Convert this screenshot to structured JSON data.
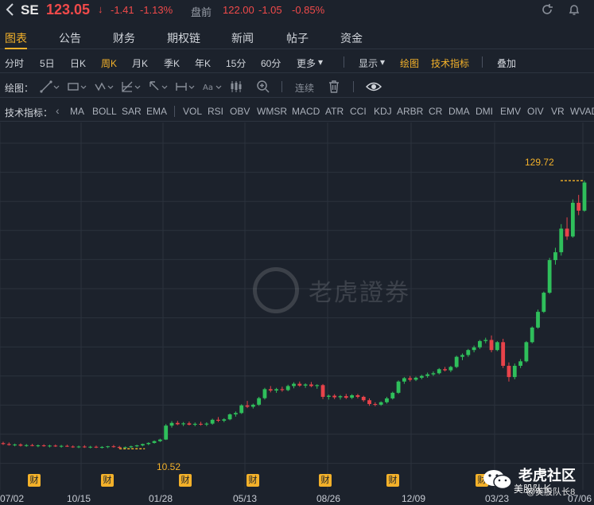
{
  "header": {
    "symbol": "SE",
    "price": "123.05",
    "price_arrow": "↓",
    "change": "-1.41",
    "change_pct": "-1.13%",
    "premarket_label": "盘前",
    "premarket_price": "122.00",
    "premarket_change": "-1.05",
    "premarket_pct": "-0.85%"
  },
  "tabs": [
    {
      "label": "图表",
      "active": true
    },
    {
      "label": "公告"
    },
    {
      "label": "财务"
    },
    {
      "label": "期权链"
    },
    {
      "label": "新闻"
    },
    {
      "label": "帖子"
    },
    {
      "label": "资金"
    }
  ],
  "periods": [
    {
      "label": "分时"
    },
    {
      "label": "5日"
    },
    {
      "label": "日K"
    },
    {
      "label": "周K",
      "active": true
    },
    {
      "label": "月K"
    },
    {
      "label": "季K"
    },
    {
      "label": "年K"
    },
    {
      "label": "15分"
    },
    {
      "label": "60分"
    },
    {
      "label": "更多"
    },
    {
      "label": "显示"
    },
    {
      "label": "绘图",
      "active": true
    },
    {
      "label": "技术指标",
      "active": true
    },
    {
      "label": "叠加"
    }
  ],
  "draw_bar": {
    "label": "绘图：",
    "continuous": "连续"
  },
  "indicators": {
    "label": "技术指标：",
    "items": [
      "MA",
      "BOLL",
      "SAR",
      "EMA",
      "VOL",
      "RSI",
      "OBV",
      "WMSR",
      "MACD",
      "ATR",
      "CCI",
      "KDJ",
      "ARBR",
      "CR",
      "DMA",
      "DMI",
      "EMV",
      "OIV",
      "VR",
      "WVAD"
    ]
  },
  "watermark": "老虎證券",
  "fin_badge": "财",
  "brand": {
    "name": "老虎社区",
    "sub": "美股队长",
    "handle": "@美股队长8"
  },
  "colors": {
    "up": "#2fbf5b",
    "down": "#e8434a",
    "accent": "#f3b12a",
    "background": "#1c222c"
  },
  "chart_data": {
    "type": "candlestick",
    "x_labels": [
      "07/02",
      "10/15",
      "01/28",
      "05/13",
      "08/26",
      "12/09",
      "03/23",
      "07/06"
    ],
    "high_marker": "129.72",
    "low_marker": "10.52",
    "y_range": [
      0,
      150
    ],
    "grid": true,
    "candles": [
      {
        "o": 13.0,
        "h": 13.6,
        "l": 12.2,
        "c": 12.6
      },
      {
        "o": 12.6,
        "h": 13.3,
        "l": 11.9,
        "c": 12.2
      },
      {
        "o": 12.2,
        "h": 12.8,
        "l": 11.6,
        "c": 12.4
      },
      {
        "o": 12.4,
        "h": 12.9,
        "l": 11.5,
        "c": 11.9
      },
      {
        "o": 11.9,
        "h": 12.6,
        "l": 11.4,
        "c": 12.1
      },
      {
        "o": 12.1,
        "h": 12.7,
        "l": 11.6,
        "c": 11.8
      },
      {
        "o": 11.8,
        "h": 12.4,
        "l": 11.2,
        "c": 12.0
      },
      {
        "o": 12.0,
        "h": 12.5,
        "l": 11.4,
        "c": 11.7
      },
      {
        "o": 11.7,
        "h": 12.3,
        "l": 11.1,
        "c": 11.9
      },
      {
        "o": 11.9,
        "h": 12.4,
        "l": 11.3,
        "c": 11.6
      },
      {
        "o": 11.6,
        "h": 12.2,
        "l": 11.0,
        "c": 11.8
      },
      {
        "o": 11.8,
        "h": 12.3,
        "l": 11.3,
        "c": 11.5
      },
      {
        "o": 11.5,
        "h": 12.0,
        "l": 10.9,
        "c": 11.3
      },
      {
        "o": 11.3,
        "h": 11.9,
        "l": 10.8,
        "c": 11.5
      },
      {
        "o": 11.5,
        "h": 12.1,
        "l": 10.9,
        "c": 11.2
      },
      {
        "o": 11.2,
        "h": 11.8,
        "l": 10.7,
        "c": 11.4
      },
      {
        "o": 11.4,
        "h": 11.9,
        "l": 10.8,
        "c": 11.1
      },
      {
        "o": 11.1,
        "h": 11.7,
        "l": 10.6,
        "c": 11.3
      },
      {
        "o": 11.3,
        "h": 11.8,
        "l": 10.8,
        "c": 11.6
      },
      {
        "o": 11.6,
        "h": 12.2,
        "l": 11.0,
        "c": 11.3
      },
      {
        "o": 11.3,
        "h": 11.8,
        "l": 10.5,
        "c": 10.9
      },
      {
        "o": 10.9,
        "h": 11.5,
        "l": 10.52,
        "c": 11.2
      },
      {
        "o": 11.2,
        "h": 11.9,
        "l": 10.8,
        "c": 11.6
      },
      {
        "o": 11.6,
        "h": 12.3,
        "l": 11.2,
        "c": 12.0
      },
      {
        "o": 12.0,
        "h": 12.8,
        "l": 11.6,
        "c": 12.6
      },
      {
        "o": 12.6,
        "h": 13.4,
        "l": 12.1,
        "c": 13.1
      },
      {
        "o": 13.1,
        "h": 14.2,
        "l": 12.8,
        "c": 13.9
      },
      {
        "o": 13.9,
        "h": 15.0,
        "l": 13.5,
        "c": 14.6
      },
      {
        "o": 14.6,
        "h": 21.5,
        "l": 14.4,
        "c": 20.8
      },
      {
        "o": 20.8,
        "h": 22.8,
        "l": 19.9,
        "c": 22.0
      },
      {
        "o": 22.0,
        "h": 22.9,
        "l": 21.0,
        "c": 21.4
      },
      {
        "o": 21.4,
        "h": 22.4,
        "l": 20.6,
        "c": 21.8
      },
      {
        "o": 21.8,
        "h": 22.6,
        "l": 20.9,
        "c": 21.2
      },
      {
        "o": 21.2,
        "h": 22.2,
        "l": 20.5,
        "c": 21.6
      },
      {
        "o": 21.6,
        "h": 22.5,
        "l": 20.8,
        "c": 21.3
      },
      {
        "o": 21.3,
        "h": 22.3,
        "l": 20.6,
        "c": 21.7
      },
      {
        "o": 21.7,
        "h": 23.9,
        "l": 21.2,
        "c": 23.4
      },
      {
        "o": 23.4,
        "h": 24.6,
        "l": 22.4,
        "c": 23.0
      },
      {
        "o": 23.0,
        "h": 24.1,
        "l": 22.3,
        "c": 23.6
      },
      {
        "o": 23.6,
        "h": 26.2,
        "l": 23.2,
        "c": 25.8
      },
      {
        "o": 25.8,
        "h": 27.1,
        "l": 24.8,
        "c": 26.4
      },
      {
        "o": 26.4,
        "h": 30.3,
        "l": 26.0,
        "c": 29.8
      },
      {
        "o": 29.8,
        "h": 31.8,
        "l": 28.6,
        "c": 29.2
      },
      {
        "o": 29.2,
        "h": 30.6,
        "l": 28.4,
        "c": 30.1
      },
      {
        "o": 30.1,
        "h": 33.6,
        "l": 29.6,
        "c": 33.0
      },
      {
        "o": 33.0,
        "h": 37.6,
        "l": 32.4,
        "c": 37.0
      },
      {
        "o": 37.0,
        "h": 38.4,
        "l": 35.6,
        "c": 36.4
      },
      {
        "o": 36.4,
        "h": 37.6,
        "l": 35.4,
        "c": 37.0
      },
      {
        "o": 37.0,
        "h": 38.1,
        "l": 35.9,
        "c": 36.6
      },
      {
        "o": 36.6,
        "h": 39.0,
        "l": 36.1,
        "c": 38.4
      },
      {
        "o": 38.4,
        "h": 40.1,
        "l": 37.4,
        "c": 39.4
      },
      {
        "o": 39.4,
        "h": 40.4,
        "l": 38.1,
        "c": 38.6
      },
      {
        "o": 38.6,
        "h": 39.6,
        "l": 37.6,
        "c": 39.1
      },
      {
        "o": 39.1,
        "h": 40.2,
        "l": 37.9,
        "c": 38.4
      },
      {
        "o": 38.4,
        "h": 39.2,
        "l": 37.2,
        "c": 38.8
      },
      {
        "o": 38.8,
        "h": 39.3,
        "l": 32.6,
        "c": 33.6
      },
      {
        "o": 33.6,
        "h": 34.6,
        "l": 32.4,
        "c": 34.1
      },
      {
        "o": 34.1,
        "h": 34.8,
        "l": 32.6,
        "c": 33.4
      },
      {
        "o": 33.4,
        "h": 34.4,
        "l": 32.4,
        "c": 33.9
      },
      {
        "o": 33.9,
        "h": 34.9,
        "l": 32.6,
        "c": 33.2
      },
      {
        "o": 33.2,
        "h": 34.8,
        "l": 32.6,
        "c": 34.3
      },
      {
        "o": 34.3,
        "h": 34.9,
        "l": 32.9,
        "c": 33.6
      },
      {
        "o": 33.6,
        "h": 34.1,
        "l": 31.4,
        "c": 32.1
      },
      {
        "o": 32.1,
        "h": 32.9,
        "l": 29.6,
        "c": 30.4
      },
      {
        "o": 30.4,
        "h": 31.2,
        "l": 29.4,
        "c": 30.1
      },
      {
        "o": 30.1,
        "h": 31.6,
        "l": 29.6,
        "c": 31.2
      },
      {
        "o": 31.2,
        "h": 33.6,
        "l": 30.6,
        "c": 32.9
      },
      {
        "o": 32.9,
        "h": 35.9,
        "l": 32.4,
        "c": 35.4
      },
      {
        "o": 35.4,
        "h": 40.9,
        "l": 34.9,
        "c": 40.4
      },
      {
        "o": 40.4,
        "h": 42.4,
        "l": 39.4,
        "c": 41.9
      },
      {
        "o": 41.9,
        "h": 42.9,
        "l": 40.4,
        "c": 41.2
      },
      {
        "o": 41.2,
        "h": 42.6,
        "l": 40.6,
        "c": 42.1
      },
      {
        "o": 42.1,
        "h": 43.4,
        "l": 41.4,
        "c": 42.9
      },
      {
        "o": 42.9,
        "h": 44.4,
        "l": 42.1,
        "c": 43.6
      },
      {
        "o": 43.6,
        "h": 44.9,
        "l": 42.9,
        "c": 44.1
      },
      {
        "o": 44.1,
        "h": 46.4,
        "l": 43.6,
        "c": 45.9
      },
      {
        "o": 45.9,
        "h": 46.9,
        "l": 44.9,
        "c": 45.4
      },
      {
        "o": 45.4,
        "h": 47.4,
        "l": 44.6,
        "c": 46.9
      },
      {
        "o": 46.9,
        "h": 51.9,
        "l": 46.4,
        "c": 51.4
      },
      {
        "o": 51.4,
        "h": 52.9,
        "l": 49.9,
        "c": 52.2
      },
      {
        "o": 52.2,
        "h": 54.9,
        "l": 51.4,
        "c": 54.4
      },
      {
        "o": 54.4,
        "h": 56.4,
        "l": 53.4,
        "c": 55.6
      },
      {
        "o": 55.6,
        "h": 58.9,
        "l": 54.9,
        "c": 58.4
      },
      {
        "o": 58.4,
        "h": 59.9,
        "l": 57.4,
        "c": 58.9
      },
      {
        "o": 58.9,
        "h": 60.9,
        "l": 53.4,
        "c": 54.4
      },
      {
        "o": 54.4,
        "h": 58.4,
        "l": 53.9,
        "c": 57.9
      },
      {
        "o": 57.9,
        "h": 59.4,
        "l": 46.4,
        "c": 47.4
      },
      {
        "o": 47.4,
        "h": 48.9,
        "l": 40.4,
        "c": 42.4
      },
      {
        "o": 42.4,
        "h": 48.4,
        "l": 41.4,
        "c": 47.4
      },
      {
        "o": 47.4,
        "h": 50.4,
        "l": 46.4,
        "c": 49.4
      },
      {
        "o": 49.4,
        "h": 58.4,
        "l": 48.9,
        "c": 57.9
      },
      {
        "o": 57.9,
        "h": 64.9,
        "l": 57.4,
        "c": 64.4
      },
      {
        "o": 64.4,
        "h": 72.4,
        "l": 63.9,
        "c": 71.4
      },
      {
        "o": 71.4,
        "h": 80.4,
        "l": 70.9,
        "c": 79.9
      },
      {
        "o": 79.9,
        "h": 95.4,
        "l": 79.4,
        "c": 94.4
      },
      {
        "o": 94.4,
        "h": 99.9,
        "l": 92.4,
        "c": 97.9
      },
      {
        "o": 97.9,
        "h": 110.4,
        "l": 96.4,
        "c": 108.4
      },
      {
        "o": 108.4,
        "h": 113.4,
        "l": 103.4,
        "c": 104.9
      },
      {
        "o": 104.9,
        "h": 121.4,
        "l": 104.4,
        "c": 119.9
      },
      {
        "o": 119.9,
        "h": 123.4,
        "l": 114.4,
        "c": 116.4
      },
      {
        "o": 116.4,
        "h": 129.72,
        "l": 115.9,
        "c": 128.9
      }
    ]
  }
}
